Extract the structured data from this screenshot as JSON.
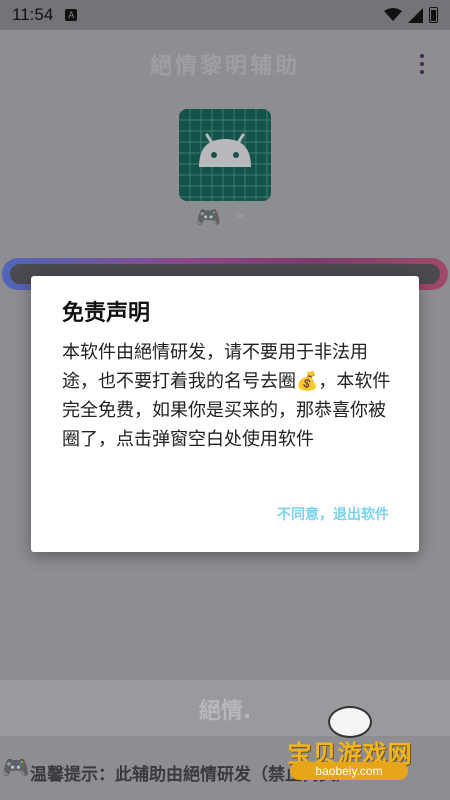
{
  "status_bar": {
    "time": "11:54",
    "notification_icon": "A",
    "icons": [
      "wifi-icon",
      "signal-icon",
      "battery-icon"
    ]
  },
  "app": {
    "title": "絕情黎明辅助",
    "menu_icon": "more-vert-icon",
    "app_icon": "android-icon",
    "bottom_text": "絕情.",
    "marquee_text": "温馨提示：此辅助由絕情研发（禁止倒卖）"
  },
  "dialog": {
    "title": "免责声明",
    "body": "本软件由絕情研发，请不要用于非法用途，也不要打着我的名号去圈💰，本软件完全免费，如果你是买来的，那恭喜你被圈了，点击弹窗空白处使用软件",
    "button_label": "不同意，退出软件"
  },
  "watermark": {
    "text": "宝贝游戏网",
    "url": "baobeiy.com"
  },
  "colors": {
    "dialog_button": "#7ad1f0",
    "app_icon_bg": "#15524a",
    "watermark": "#f2b51c"
  }
}
